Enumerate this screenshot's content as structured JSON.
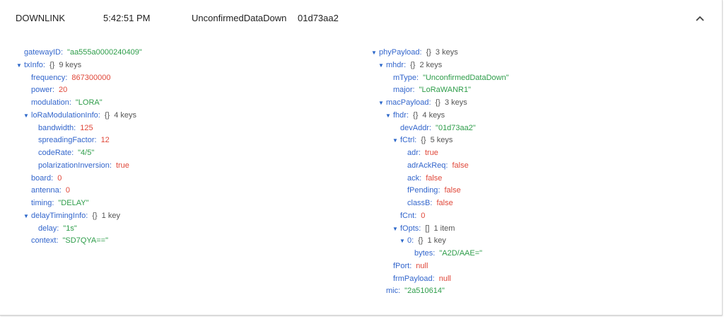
{
  "header": {
    "direction": "DOWNLINK",
    "time": "5:42:51 PM",
    "type": "UnconfirmedDataDown",
    "devaddr": "01d73aa2"
  },
  "left": [
    {
      "d": 0,
      "k": "gatewayID",
      "v": "\"aa555a0000240409\"",
      "t": "str"
    },
    {
      "d": 0,
      "k": "txInfo",
      "obj": "{}",
      "cnt": "9 keys",
      "open": true
    },
    {
      "d": 1,
      "k": "frequency",
      "v": "867300000",
      "t": "num"
    },
    {
      "d": 1,
      "k": "power",
      "v": "20",
      "t": "num"
    },
    {
      "d": 1,
      "k": "modulation",
      "v": "\"LORA\"",
      "t": "str"
    },
    {
      "d": 1,
      "k": "loRaModulationInfo",
      "obj": "{}",
      "cnt": "4 keys",
      "open": true
    },
    {
      "d": 2,
      "k": "bandwidth",
      "v": "125",
      "t": "num"
    },
    {
      "d": 2,
      "k": "spreadingFactor",
      "v": "12",
      "t": "num"
    },
    {
      "d": 2,
      "k": "codeRate",
      "v": "\"4/5\"",
      "t": "str"
    },
    {
      "d": 2,
      "k": "polarizationInversion",
      "v": "true",
      "t": "lit"
    },
    {
      "d": 1,
      "k": "board",
      "v": "0",
      "t": "num"
    },
    {
      "d": 1,
      "k": "antenna",
      "v": "0",
      "t": "num"
    },
    {
      "d": 1,
      "k": "timing",
      "v": "\"DELAY\"",
      "t": "str"
    },
    {
      "d": 1,
      "k": "delayTimingInfo",
      "obj": "{}",
      "cnt": "1 key",
      "open": true
    },
    {
      "d": 2,
      "k": "delay",
      "v": "\"1s\"",
      "t": "str"
    },
    {
      "d": 1,
      "k": "context",
      "v": "\"SD7QYA==\"",
      "t": "str"
    }
  ],
  "right": [
    {
      "d": 0,
      "k": "phyPayload",
      "obj": "{}",
      "cnt": "3 keys",
      "open": true
    },
    {
      "d": 1,
      "k": "mhdr",
      "obj": "{}",
      "cnt": "2 keys",
      "open": true
    },
    {
      "d": 2,
      "k": "mType",
      "v": "\"UnconfirmedDataDown\"",
      "t": "str"
    },
    {
      "d": 2,
      "k": "major",
      "v": "\"LoRaWANR1\"",
      "t": "str"
    },
    {
      "d": 1,
      "k": "macPayload",
      "obj": "{}",
      "cnt": "3 keys",
      "open": true
    },
    {
      "d": 2,
      "k": "fhdr",
      "obj": "{}",
      "cnt": "4 keys",
      "open": true
    },
    {
      "d": 3,
      "k": "devAddr",
      "v": "\"01d73aa2\"",
      "t": "str"
    },
    {
      "d": 3,
      "k": "fCtrl",
      "obj": "{}",
      "cnt": "5 keys",
      "open": true
    },
    {
      "d": 4,
      "k": "adr",
      "v": "true",
      "t": "lit"
    },
    {
      "d": 4,
      "k": "adrAckReq",
      "v": "false",
      "t": "lit"
    },
    {
      "d": 4,
      "k": "ack",
      "v": "false",
      "t": "lit"
    },
    {
      "d": 4,
      "k": "fPending",
      "v": "false",
      "t": "lit"
    },
    {
      "d": 4,
      "k": "classB",
      "v": "false",
      "t": "lit"
    },
    {
      "d": 3,
      "k": "fCnt",
      "v": "0",
      "t": "num"
    },
    {
      "d": 3,
      "k": "fOpts",
      "obj": "[]",
      "cnt": "1 item",
      "open": true
    },
    {
      "d": 4,
      "k": "0",
      "obj": "{}",
      "cnt": "1 key",
      "open": true
    },
    {
      "d": 5,
      "k": "bytes",
      "v": "\"A2D/AAE=\"",
      "t": "str"
    },
    {
      "d": 2,
      "k": "fPort",
      "v": "null",
      "t": "lit"
    },
    {
      "d": 2,
      "k": "frmPayload",
      "v": "null",
      "t": "lit"
    },
    {
      "d": 1,
      "k": "mic",
      "v": "\"2a510614\"",
      "t": "str"
    }
  ],
  "icons": {
    "collapse": "chevron-up-icon",
    "toggle": "caret-down-icon"
  }
}
